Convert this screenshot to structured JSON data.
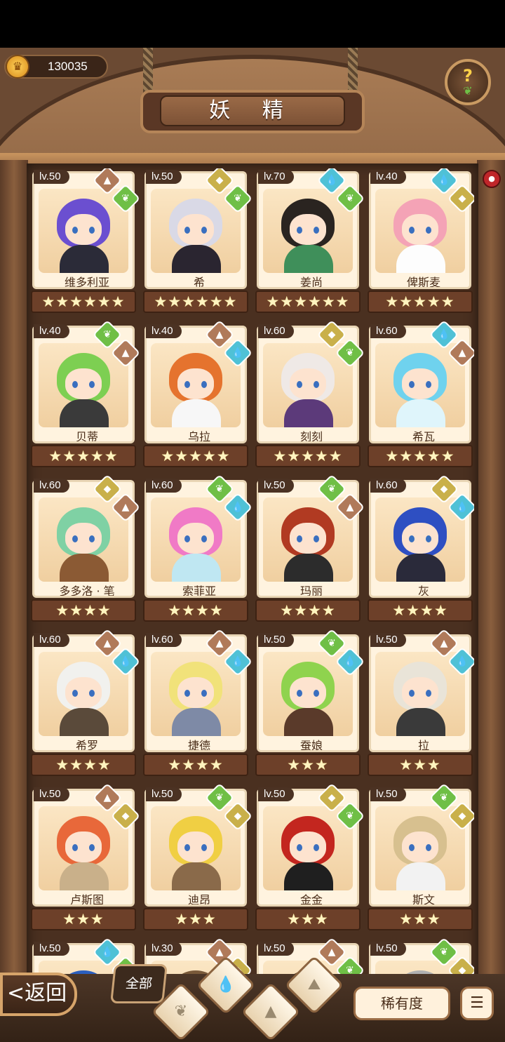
{
  "header": {
    "coins": "130035",
    "title": "妖 精",
    "help_icon": "question-sprout-icon"
  },
  "colors": {
    "earth": "#b07a5a",
    "water": "#4fc1d6",
    "grass": "#6fbf46",
    "light": "#c9b04a"
  },
  "cards": [
    {
      "lv": "lv.50",
      "name": "维多利亚",
      "stars": "★★★★★★",
      "hair": "#6b4fd0",
      "body": "#2b2b38",
      "e1": "earth",
      "e2": "grass"
    },
    {
      "lv": "lv.50",
      "name": "希",
      "stars": "★★★★★★",
      "hair": "#d9d9e6",
      "body": "#2a2530",
      "e1": "light",
      "e2": "grass"
    },
    {
      "lv": "lv.70",
      "name": "姜尚",
      "stars": "★★★★★★",
      "hair": "#2a2420",
      "body": "#3f8f5a",
      "e1": "water",
      "e2": "grass"
    },
    {
      "lv": "lv.40",
      "name": "俾斯麦",
      "stars": "★★★★★",
      "hair": "#f4a3b6",
      "body": "#fdfdfd",
      "e1": "water",
      "e2": "light"
    },
    {
      "lv": "lv.40",
      "name": "贝蒂",
      "stars": "★★★★★",
      "hair": "#7dcf52",
      "body": "#3a3a3a",
      "e1": "grass",
      "e2": "earth"
    },
    {
      "lv": "lv.40",
      "name": "乌拉",
      "stars": "★★★★★",
      "hair": "#e5732e",
      "body": "#f7f7f7",
      "e1": "earth",
      "e2": "water"
    },
    {
      "lv": "lv.60",
      "name": "刻刻",
      "stars": "★★★★★",
      "hair": "#efe9e6",
      "body": "#5c3a7a",
      "e1": "light",
      "e2": "grass"
    },
    {
      "lv": "lv.60",
      "name": "希瓦",
      "stars": "★★★★★",
      "hair": "#6fd2ee",
      "body": "#dff5fb",
      "e1": "water",
      "e2": "earth"
    },
    {
      "lv": "lv.60",
      "name": "多多洛 · 笔",
      "stars": "★★★★",
      "hair": "#7fd1a4",
      "body": "#8b5a34",
      "e1": "light",
      "e2": "earth"
    },
    {
      "lv": "lv.60",
      "name": "索菲亚",
      "stars": "★★★★",
      "hair": "#f07ac6",
      "body": "#bfe7f2",
      "e1": "grass",
      "e2": "water"
    },
    {
      "lv": "lv.50",
      "name": "玛丽",
      "stars": "★★★★",
      "hair": "#b13a22",
      "body": "#2c2c2c",
      "e1": "grass",
      "e2": "earth"
    },
    {
      "lv": "lv.60",
      "name": "灰",
      "stars": "★★★★",
      "hair": "#2e4fc2",
      "body": "#2a2a3a",
      "e1": "light",
      "e2": "water"
    },
    {
      "lv": "lv.60",
      "name": "希罗",
      "stars": "★★★★",
      "hair": "#f1f1ee",
      "body": "#5a4a3a",
      "e1": "earth",
      "e2": "water"
    },
    {
      "lv": "lv.60",
      "name": "捷德",
      "stars": "★★★★",
      "hair": "#f1e27a",
      "body": "#7e8aa6",
      "e1": "earth",
      "e2": "water"
    },
    {
      "lv": "lv.50",
      "name": "蚕娘",
      "stars": "★★★",
      "hair": "#8fd34e",
      "body": "#5a3a2a",
      "e1": "grass",
      "e2": "water"
    },
    {
      "lv": "lv.50",
      "name": "拉",
      "stars": "★★★",
      "hair": "#e9e4d8",
      "body": "#3a3a3a",
      "e1": "earth",
      "e2": "water"
    },
    {
      "lv": "lv.50",
      "name": "卢斯图",
      "stars": "★★★",
      "hair": "#e8683a",
      "body": "#c9b08a",
      "e1": "earth",
      "e2": "light"
    },
    {
      "lv": "lv.50",
      "name": "迪昂",
      "stars": "★★★",
      "hair": "#f0cf43",
      "body": "#8a6a4a",
      "e1": "grass",
      "e2": "light"
    },
    {
      "lv": "lv.50",
      "name": "金金",
      "stars": "★★★",
      "hair": "#c3261f",
      "body": "#1f1f1f",
      "e1": "light",
      "e2": "grass"
    },
    {
      "lv": "lv.50",
      "name": "斯文",
      "stars": "★★★",
      "hair": "#d7c08f",
      "body": "#f2f2f2",
      "e1": "grass",
      "e2": "light"
    },
    {
      "lv": "lv.50",
      "name": "",
      "stars": "",
      "hair": "#2b5fbf",
      "body": "#3a3a3a",
      "e1": "water",
      "e2": "grass"
    },
    {
      "lv": "lv.30",
      "name": "",
      "stars": "",
      "hair": "#7a5a3a",
      "body": "#3a3a3a",
      "e1": "earth",
      "e2": "light"
    },
    {
      "lv": "lv.50",
      "name": "",
      "stars": "",
      "hair": "#6a4a2a",
      "body": "#3a3a3a",
      "e1": "earth",
      "e2": "grass"
    },
    {
      "lv": "lv.50",
      "name": "",
      "stars": "",
      "hair": "#b0b0b0",
      "body": "#3a3a3a",
      "e1": "grass",
      "e2": "light"
    }
  ],
  "bottom": {
    "back_label": "<返回",
    "all_label": "全部",
    "sort_label": "稀有度",
    "order_icon": "sort-order-icon"
  }
}
